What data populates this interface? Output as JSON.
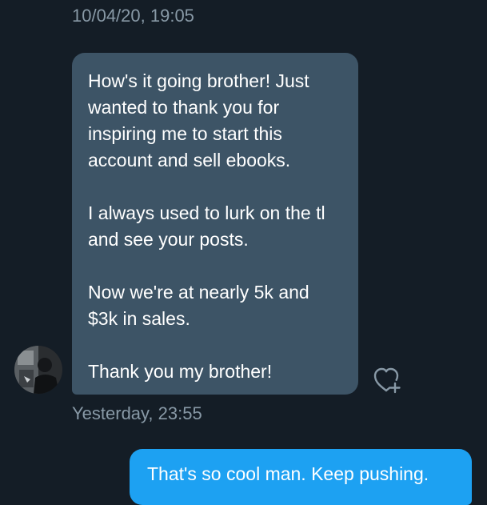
{
  "conversation": {
    "timestamp_top": "10/04/20, 19:05",
    "received_message": {
      "paragraphs": [
        "How's it going brother! Just wanted to thank you for inspiring me to start this account and sell ebooks.",
        "I always used to lurk on the tl and see your posts.",
        "Now we're at nearly 5k and $3k in sales.",
        "Thank you my brother!"
      ],
      "timestamp": "Yesterday, 23:55",
      "like_icon": "heart-plus-icon"
    },
    "sent_message": {
      "text": "That's so cool man. Keep pushing."
    }
  },
  "colors": {
    "background": "#141d26",
    "received_bubble": "#3d5466",
    "sent_bubble": "#1da1f2",
    "timestamp_text": "#8899a6",
    "message_text": "#ffffff"
  }
}
